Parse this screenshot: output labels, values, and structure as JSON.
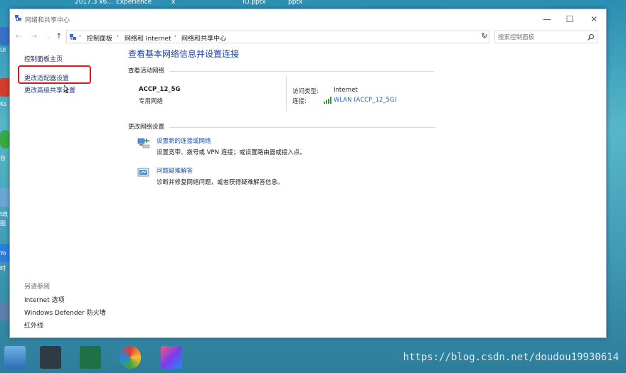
{
  "desktop": {
    "top_labels": [
      "2017.3 x6...",
      "Experience",
      "x",
      "IO.pptx",
      "pptx"
    ],
    "left_labels": [
      "Ul",
      "Ks",
      "台",
      "t改",
      "图",
      "Yo",
      "时"
    ],
    "watermark": "https://blog.csdn.net/doudou19930614"
  },
  "window": {
    "title": "网络和共享中心",
    "controls": {
      "minimize": "—",
      "maximize": "☐",
      "close": "✕"
    }
  },
  "address": {
    "breadcrumbs": [
      "控制面板",
      "网络和 Internet",
      "网络和共享中心"
    ],
    "search_placeholder": "搜索控制面板"
  },
  "left_pane": {
    "home": "控制面板主页",
    "links": [
      "更改适配器设置",
      "更改高级共享设置"
    ],
    "see_also_title": "另请参阅",
    "see_also": [
      "Internet 选项",
      "Windows Defender 防火墙",
      "红外线"
    ]
  },
  "main": {
    "title": "查看基本网络信息并设置连接",
    "active_networks_label": "查看活动网络",
    "network": {
      "name": "ACCP_12_5G",
      "category": "专用网络",
      "access_type_label": "访问类型:",
      "access_type_value": "Internet",
      "connection_label": "连接:",
      "connection_value": "WLAN (ACCP_12_5G)"
    },
    "change_settings_label": "更改网络设置",
    "tasks": [
      {
        "link": "设置新的连接或网络",
        "desc": "设置宽带、拨号或 VPN 连接；或设置路由器或接入点。"
      },
      {
        "link": "问题疑难解答",
        "desc": "诊断并修复网络问题，或者获得疑难解答信息。"
      }
    ]
  },
  "colors": {
    "link": "#2b63b7",
    "title_blue": "#1c3e9a",
    "highlight": "#e0151b",
    "wifi": "#2e9a3a"
  }
}
